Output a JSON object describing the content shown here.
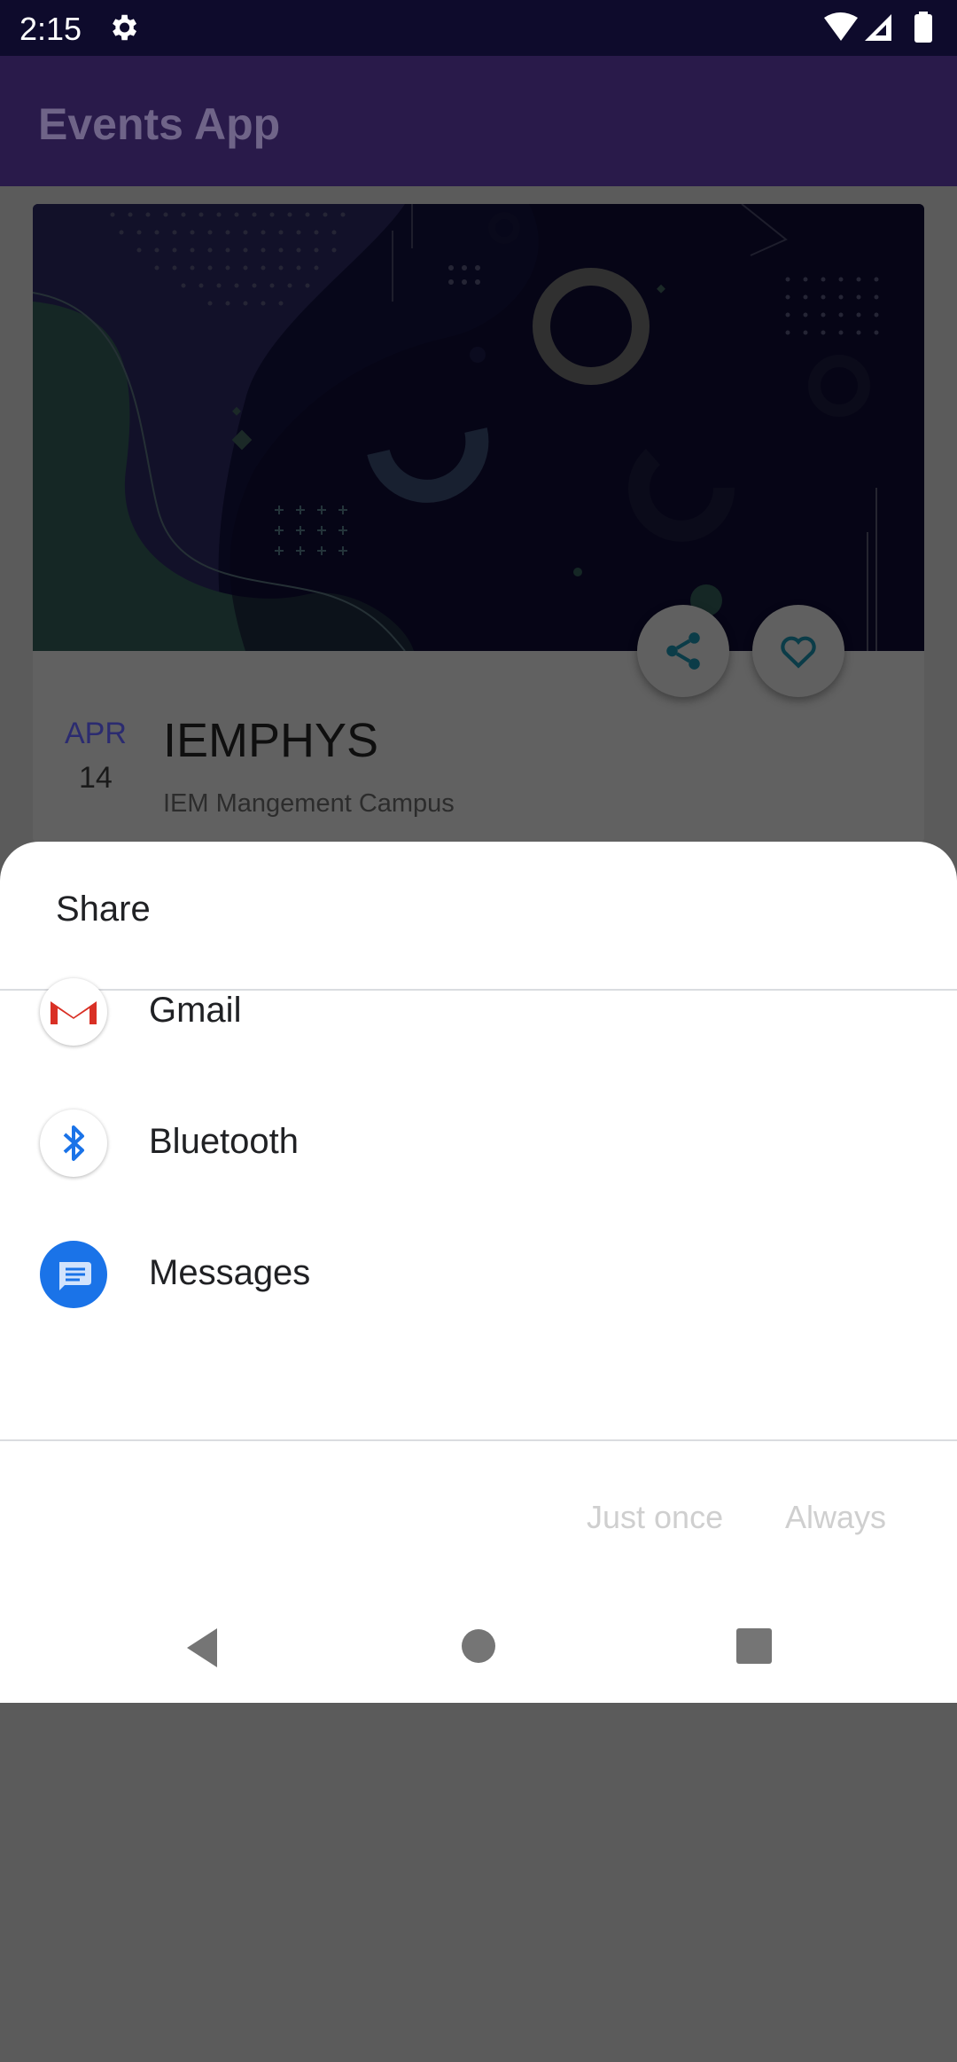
{
  "status_bar": {
    "time": "2:15",
    "icons": [
      "gear-icon",
      "wifi-icon",
      "signal-icon",
      "battery-icon"
    ]
  },
  "app_bar": {
    "title": "Events App"
  },
  "event_card": {
    "month": "APR",
    "day": "14",
    "title": "IEMPHYS",
    "location": "IEM Mangement Campus",
    "actions": [
      "share-icon",
      "favorite-icon"
    ]
  },
  "share_sheet": {
    "title": "Share",
    "apps": [
      {
        "label": "Gmail",
        "icon": "gmail-icon"
      },
      {
        "label": "Bluetooth",
        "icon": "bluetooth-icon"
      },
      {
        "label": "Messages",
        "icon": "messages-icon"
      }
    ],
    "buttons": {
      "just_once": "Just once",
      "always": "Always"
    }
  },
  "colors": {
    "status_bar": "#0e0b2c",
    "app_bar": "#291a4a",
    "scrim": "#5b5b5b",
    "sheet": "#ffffff",
    "button_disabled": "#cfcfcf"
  }
}
